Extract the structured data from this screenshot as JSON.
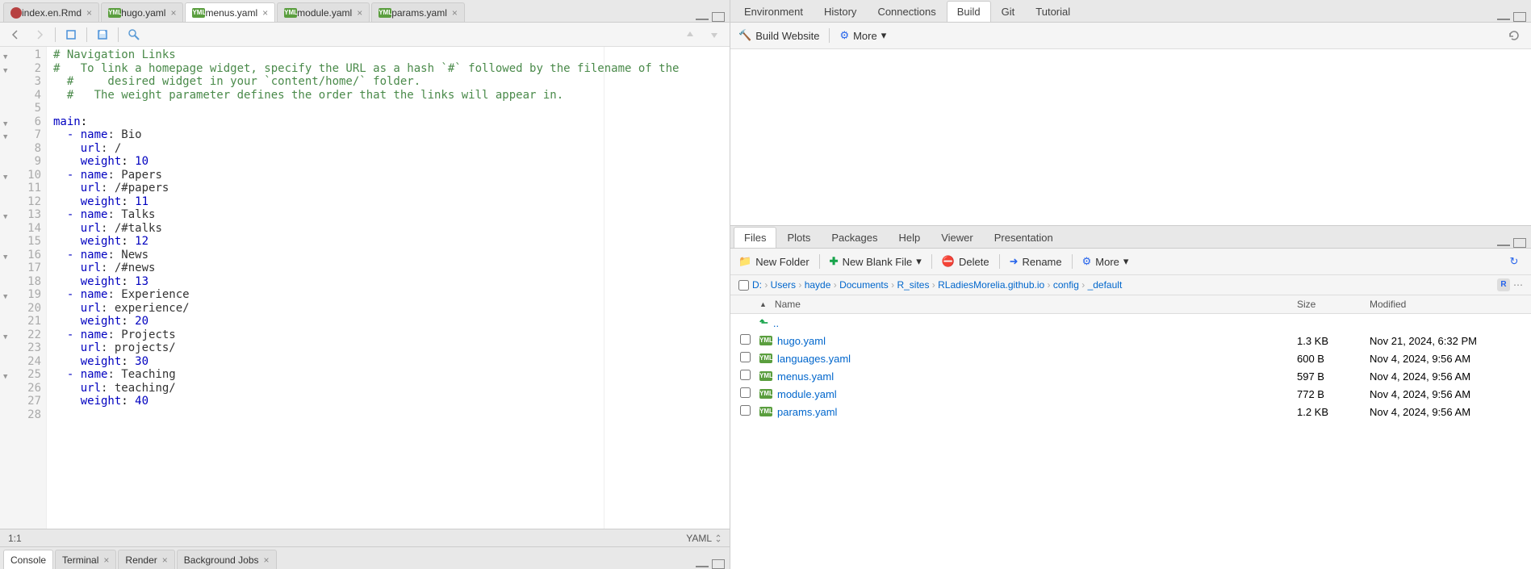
{
  "editor_tabs": [
    {
      "label": "index.en.Rmd",
      "icon": "rmd",
      "active": false
    },
    {
      "label": "hugo.yaml",
      "icon": "yml",
      "active": false
    },
    {
      "label": "menus.yaml",
      "icon": "yml",
      "active": true
    },
    {
      "label": "module.yaml",
      "icon": "yml",
      "active": false
    },
    {
      "label": "params.yaml",
      "icon": "yml",
      "active": false
    }
  ],
  "code_lines": [
    {
      "n": 1,
      "fold": true,
      "txt": "# Navigation Links",
      "cls": "c-comment"
    },
    {
      "n": 2,
      "fold": true,
      "txt": "#   To link a homepage widget, specify the URL as a hash `#` followed by the filename of the",
      "cls": "c-comment"
    },
    {
      "n": 3,
      "fold": false,
      "txt": "  #     desired widget in your `content/home/` folder.",
      "cls": "c-comment"
    },
    {
      "n": 4,
      "fold": false,
      "txt": "  #   The weight parameter defines the order that the links will appear in.",
      "cls": "c-comment"
    },
    {
      "n": 5,
      "fold": false,
      "txt": "",
      "cls": ""
    },
    {
      "n": 6,
      "fold": true,
      "seg": [
        {
          "t": "main",
          "c": "c-key"
        },
        {
          "t": ":",
          "c": ""
        }
      ]
    },
    {
      "n": 7,
      "fold": true,
      "seg": [
        {
          "t": "  - ",
          "c": "c-dash"
        },
        {
          "t": "name",
          "c": "c-key"
        },
        {
          "t": ": Bio",
          "c": "c-str"
        }
      ]
    },
    {
      "n": 8,
      "fold": false,
      "seg": [
        {
          "t": "    ",
          "c": ""
        },
        {
          "t": "url",
          "c": "c-key"
        },
        {
          "t": ": /",
          "c": "c-str"
        }
      ]
    },
    {
      "n": 9,
      "fold": false,
      "seg": [
        {
          "t": "    ",
          "c": ""
        },
        {
          "t": "weight",
          "c": "c-key"
        },
        {
          "t": ": ",
          "c": ""
        },
        {
          "t": "10",
          "c": "c-num"
        }
      ]
    },
    {
      "n": 10,
      "fold": true,
      "seg": [
        {
          "t": "  - ",
          "c": "c-dash"
        },
        {
          "t": "name",
          "c": "c-key"
        },
        {
          "t": ": Papers",
          "c": "c-str"
        }
      ]
    },
    {
      "n": 11,
      "fold": false,
      "seg": [
        {
          "t": "    ",
          "c": ""
        },
        {
          "t": "url",
          "c": "c-key"
        },
        {
          "t": ": /#papers",
          "c": "c-str"
        }
      ]
    },
    {
      "n": 12,
      "fold": false,
      "seg": [
        {
          "t": "    ",
          "c": ""
        },
        {
          "t": "weight",
          "c": "c-key"
        },
        {
          "t": ": ",
          "c": ""
        },
        {
          "t": "11",
          "c": "c-num"
        }
      ]
    },
    {
      "n": 13,
      "fold": true,
      "seg": [
        {
          "t": "  - ",
          "c": "c-dash"
        },
        {
          "t": "name",
          "c": "c-key"
        },
        {
          "t": ": Talks",
          "c": "c-str"
        }
      ]
    },
    {
      "n": 14,
      "fold": false,
      "seg": [
        {
          "t": "    ",
          "c": ""
        },
        {
          "t": "url",
          "c": "c-key"
        },
        {
          "t": ": /#talks",
          "c": "c-str"
        }
      ]
    },
    {
      "n": 15,
      "fold": false,
      "seg": [
        {
          "t": "    ",
          "c": ""
        },
        {
          "t": "weight",
          "c": "c-key"
        },
        {
          "t": ": ",
          "c": ""
        },
        {
          "t": "12",
          "c": "c-num"
        }
      ]
    },
    {
      "n": 16,
      "fold": true,
      "seg": [
        {
          "t": "  - ",
          "c": "c-dash"
        },
        {
          "t": "name",
          "c": "c-key"
        },
        {
          "t": ": News",
          "c": "c-str"
        }
      ]
    },
    {
      "n": 17,
      "fold": false,
      "seg": [
        {
          "t": "    ",
          "c": ""
        },
        {
          "t": "url",
          "c": "c-key"
        },
        {
          "t": ": /#news",
          "c": "c-str"
        }
      ]
    },
    {
      "n": 18,
      "fold": false,
      "seg": [
        {
          "t": "    ",
          "c": ""
        },
        {
          "t": "weight",
          "c": "c-key"
        },
        {
          "t": ": ",
          "c": ""
        },
        {
          "t": "13",
          "c": "c-num"
        }
      ]
    },
    {
      "n": 19,
      "fold": true,
      "seg": [
        {
          "t": "  - ",
          "c": "c-dash"
        },
        {
          "t": "name",
          "c": "c-key"
        },
        {
          "t": ": Experience",
          "c": "c-str"
        }
      ]
    },
    {
      "n": 20,
      "fold": false,
      "seg": [
        {
          "t": "    ",
          "c": ""
        },
        {
          "t": "url",
          "c": "c-key"
        },
        {
          "t": ": experience/",
          "c": "c-str"
        }
      ]
    },
    {
      "n": 21,
      "fold": false,
      "seg": [
        {
          "t": "    ",
          "c": ""
        },
        {
          "t": "weight",
          "c": "c-key"
        },
        {
          "t": ": ",
          "c": ""
        },
        {
          "t": "20",
          "c": "c-num"
        }
      ]
    },
    {
      "n": 22,
      "fold": true,
      "seg": [
        {
          "t": "  - ",
          "c": "c-dash"
        },
        {
          "t": "name",
          "c": "c-key"
        },
        {
          "t": ": Projects",
          "c": "c-str"
        }
      ]
    },
    {
      "n": 23,
      "fold": false,
      "seg": [
        {
          "t": "    ",
          "c": ""
        },
        {
          "t": "url",
          "c": "c-key"
        },
        {
          "t": ": projects/",
          "c": "c-str"
        }
      ]
    },
    {
      "n": 24,
      "fold": false,
      "seg": [
        {
          "t": "    ",
          "c": ""
        },
        {
          "t": "weight",
          "c": "c-key"
        },
        {
          "t": ": ",
          "c": ""
        },
        {
          "t": "30",
          "c": "c-num"
        }
      ]
    },
    {
      "n": 25,
      "fold": true,
      "seg": [
        {
          "t": "  - ",
          "c": "c-dash"
        },
        {
          "t": "name",
          "c": "c-key"
        },
        {
          "t": ": Teaching",
          "c": "c-str"
        }
      ]
    },
    {
      "n": 26,
      "fold": false,
      "seg": [
        {
          "t": "    ",
          "c": ""
        },
        {
          "t": "url",
          "c": "c-key"
        },
        {
          "t": ": teaching/",
          "c": "c-str"
        }
      ]
    },
    {
      "n": 27,
      "fold": false,
      "seg": [
        {
          "t": "    ",
          "c": ""
        },
        {
          "t": "weight",
          "c": "c-key"
        },
        {
          "t": ": ",
          "c": ""
        },
        {
          "t": "40",
          "c": "c-num"
        }
      ]
    },
    {
      "n": 28,
      "fold": false,
      "txt": "",
      "cls": ""
    }
  ],
  "cursor_pos": "1:1",
  "language": "YAML",
  "bottom_tabs": [
    {
      "label": "Console",
      "active": true,
      "close": false
    },
    {
      "label": "Terminal",
      "active": false,
      "close": true
    },
    {
      "label": "Render",
      "active": false,
      "close": true
    },
    {
      "label": "Background Jobs",
      "active": false,
      "close": true
    }
  ],
  "top_right_tabs": [
    "Environment",
    "History",
    "Connections",
    "Build",
    "Git",
    "Tutorial"
  ],
  "top_right_active": "Build",
  "build_toolbar": {
    "build_website": "Build Website",
    "more": "More"
  },
  "bottom_right_tabs": [
    "Files",
    "Plots",
    "Packages",
    "Help",
    "Viewer",
    "Presentation"
  ],
  "bottom_right_active": "Files",
  "files_toolbar": {
    "new_folder": "New Folder",
    "new_blank": "New Blank File",
    "delete": "Delete",
    "rename": "Rename",
    "more": "More"
  },
  "breadcrumb": [
    "D:",
    "Users",
    "hayde",
    "Documents",
    "R_sites",
    "RLadiesMorelia.github.io",
    "config",
    "_default"
  ],
  "file_headers": {
    "name": "Name",
    "size": "Size",
    "modified": "Modified"
  },
  "parent_dir": "..",
  "files": [
    {
      "name": "hugo.yaml",
      "size": "1.3 KB",
      "modified": "Nov 21, 2024, 6:32 PM"
    },
    {
      "name": "languages.yaml",
      "size": "600 B",
      "modified": "Nov 4, 2024, 9:56 AM"
    },
    {
      "name": "menus.yaml",
      "size": "597 B",
      "modified": "Nov 4, 2024, 9:56 AM"
    },
    {
      "name": "module.yaml",
      "size": "772 B",
      "modified": "Nov 4, 2024, 9:56 AM"
    },
    {
      "name": "params.yaml",
      "size": "1.2 KB",
      "modified": "Nov 4, 2024, 9:56 AM"
    }
  ]
}
